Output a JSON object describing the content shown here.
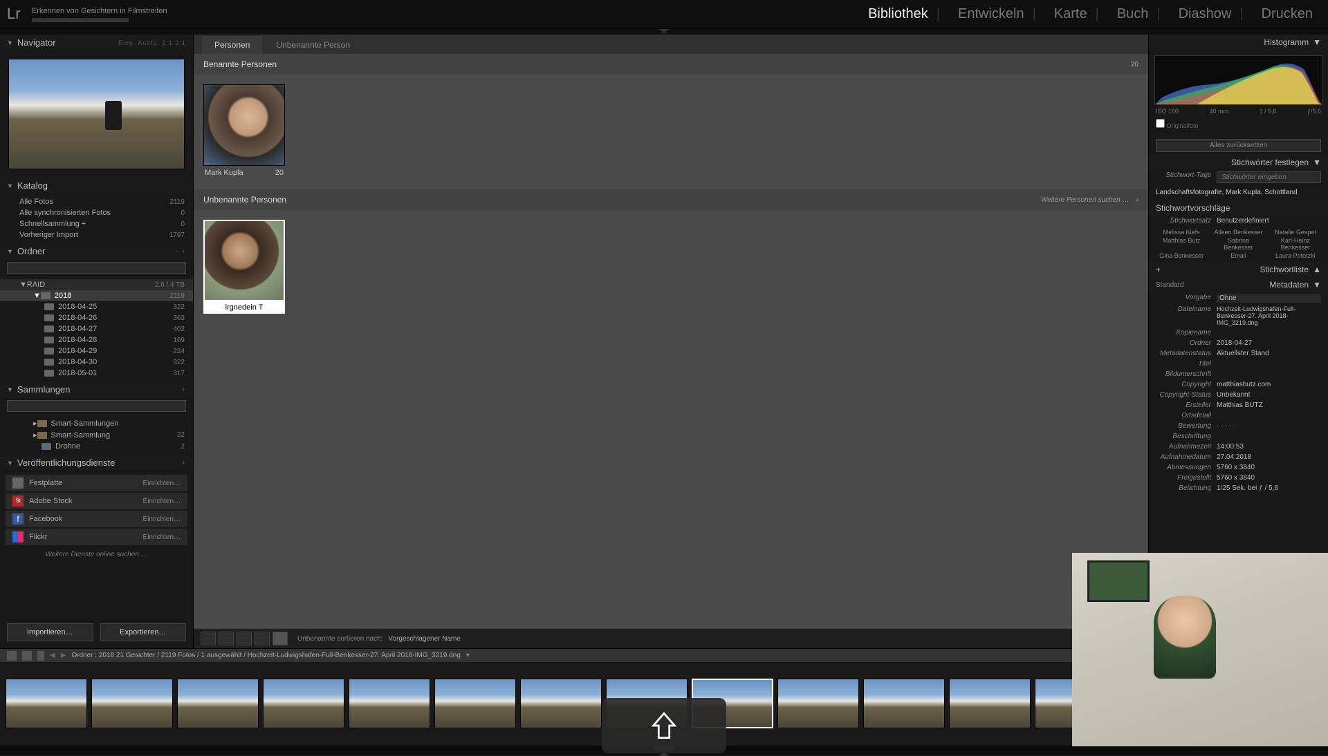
{
  "top": {
    "task": "Erkennen von Gesichtern in Filmstreifen",
    "modules": [
      "Bibliothek",
      "Entwickeln",
      "Karte",
      "Buch",
      "Diashow",
      "Drucken"
    ],
    "active_module": "Bibliothek"
  },
  "nav": {
    "title": "Navigator",
    "opts": "Einp.  Ausfü.  1:1  3:1"
  },
  "catalog": {
    "title": "Katalog",
    "items": [
      {
        "label": "Alle Fotos",
        "count": "2119"
      },
      {
        "label": "Alle synchronisierten Fotos",
        "count": "0"
      },
      {
        "label": "Schnellsammlung  +",
        "count": "0"
      },
      {
        "label": "Vorheriger Import",
        "count": "1797"
      }
    ]
  },
  "folders": {
    "title": "Ordner",
    "volume": {
      "name": "RAID",
      "info": "2,6 / 4 TB"
    },
    "root": {
      "name": "2018",
      "count": "2119"
    },
    "children": [
      {
        "name": "2018-04-25",
        "count": "322"
      },
      {
        "name": "2018-04-26",
        "count": "363"
      },
      {
        "name": "2018-04-27",
        "count": "402"
      },
      {
        "name": "2018-04-28",
        "count": "169"
      },
      {
        "name": "2018-04-29",
        "count": "224"
      },
      {
        "name": "2018-04-30",
        "count": "322"
      },
      {
        "name": "2018-05-01",
        "count": "317"
      }
    ]
  },
  "collections": {
    "title": "Sammlungen",
    "items": [
      {
        "label": "Smart-Sammlungen",
        "count": ""
      },
      {
        "label": "Smart-Sammlung",
        "count": "22"
      },
      {
        "label": "Drohne",
        "count": "2"
      }
    ]
  },
  "publish": {
    "title": "Veröffentlichungsdienste",
    "services": [
      {
        "name": "Festplatte",
        "btn": "Einrichten…",
        "color": "#666"
      },
      {
        "name": "Adobe Stock",
        "btn": "Einrichten…",
        "color": "#b02a2a"
      },
      {
        "name": "Facebook",
        "btn": "Einrichten…",
        "color": "#3b5998"
      },
      {
        "name": "Flickr",
        "btn": "Einrichten…",
        "color": "#e82a6a"
      }
    ],
    "more": "Weitere Dienste online suchen …"
  },
  "btns": {
    "import": "Importieren…",
    "export": "Exportieren…"
  },
  "tabs": {
    "active": "Personen",
    "second": "Unbenannte Person"
  },
  "named": {
    "title": "Benannte Personen",
    "count": "20",
    "people": [
      {
        "name": "Mark Kupla",
        "count": "20"
      }
    ]
  },
  "unnamed": {
    "title": "Unbenannte Personen",
    "more": "Weitere Personen suchen …",
    "more_btn": "›",
    "input_value": "irgnedein T"
  },
  "toolbar": {
    "sort_label": "Unbenannte sortieren nach:",
    "sort_value": "Vorgeschlagener Name"
  },
  "right": {
    "histogram": "Histogramm",
    "histo_meta": {
      "iso": "ISO 160",
      "focal": "40 mm",
      "exp": "1 / 5,6",
      "units": "ƒ/5,6"
    },
    "orig": "Originalfoto",
    "reset": "Alles zurücksetzen",
    "kw_set": "Stichwörter festlegen",
    "kw_tags_label": "Stichwort-Tags",
    "kw_placeholder": "Stichwörter eingeben",
    "kw_tags_value": "Landschaftsfotografie, Mark Kupla, Schottland",
    "kw_sugg": "Stichwortvorschläge",
    "kw_set_label": "Stichwortsatz",
    "kw_set_value": "Benutzerdefiniert",
    "sugg": [
      "Melissa Kiefs",
      "Aileen Benkesser",
      "Natalie Gespel",
      "Matthias Butz",
      "Sabrina Benkesser",
      "Karl-Heinz Benkesser",
      "Gina Benkesser",
      "Email",
      "Laura Pototzki"
    ],
    "kw_list": "Stichwortliste",
    "meta_hdr": "Metadaten",
    "meta_preset": "Standard",
    "meta": [
      {
        "k": "Vorgabe",
        "v": "Ohne"
      },
      {
        "k": "Dateiname",
        "v": "Hochzeit-Ludwigshafen-Full-Benkesser-27. April 2018-IMG_3219.dng"
      },
      {
        "k": "Kopiename",
        "v": ""
      },
      {
        "k": "Ordner",
        "v": "2018-04-27"
      },
      {
        "k": "Metadatenstatus",
        "v": "Aktuellster Stand"
      },
      {
        "k": "Titel",
        "v": ""
      },
      {
        "k": "Bildunterschrift",
        "v": ""
      },
      {
        "k": "Copyright",
        "v": "matthiasbutz.com"
      },
      {
        "k": "Copyright-Status",
        "v": "Unbekannt"
      },
      {
        "k": "Ersteller",
        "v": "Matthias BUTZ"
      },
      {
        "k": "Ortsdetail",
        "v": ""
      },
      {
        "k": "Bewertung",
        "v": "·  ·  ·  ·  ·"
      },
      {
        "k": "Beschriftung",
        "v": ""
      },
      {
        "k": "Aufnahmezeit",
        "v": "14:00:53"
      },
      {
        "k": "Aufnahmedatum",
        "v": "27.04.2018"
      },
      {
        "k": "Abmessungen",
        "v": "5760 x 3840"
      },
      {
        "k": "Freigestellt",
        "v": "5760 x 3840"
      },
      {
        "k": "Belichtung",
        "v": "1/25 Sek. bei ƒ / 5,6"
      }
    ]
  },
  "crumb": {
    "text": "Ordner : 2018   21 Gesichter / 2119 Fotos /  1 ausgewählt / Hochzeit-Ludwigshafen-Full-Benkesser-27. April 2018-IMG_3219.dng"
  }
}
